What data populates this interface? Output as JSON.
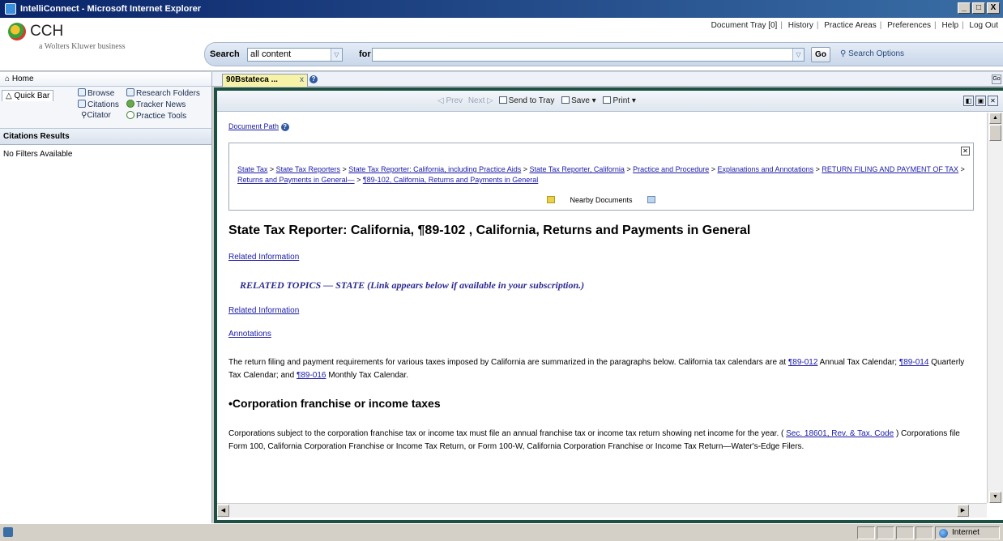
{
  "window": {
    "title": "IntelliConnect - Microsoft Internet Explorer",
    "controls": [
      "_",
      "□",
      "X"
    ]
  },
  "brand": {
    "name": "CCH",
    "tagline": "a Wolters Kluwer business"
  },
  "top_links": [
    "Document Tray [0]",
    "History",
    "Practice Areas",
    "Preferences",
    "Help",
    "Log Out"
  ],
  "search": {
    "label": "Search",
    "scope_value": "all content",
    "for_label": "for",
    "query_value": "",
    "go_label": "Go",
    "options_label": "Search Options"
  },
  "left_pane": {
    "home_label": "Home",
    "quickbar_label": "Quick Bar",
    "quick_items": {
      "browse": "Browse",
      "research_folders": "Research Folders",
      "citations": "Citations",
      "tracker_news": "Tracker News",
      "citator": "Citator",
      "practice_tools": "Practice Tools"
    },
    "results_header": "Citations Results",
    "no_filters": "No Filters Available"
  },
  "doc_tab": {
    "label": "90Bstateca ...",
    "close": "x"
  },
  "toolbar": {
    "prev": "Prev",
    "next": "Next",
    "send_to_tray": "Send to Tray",
    "save": "Save ▾",
    "print": "Print ▾"
  },
  "document": {
    "path_label": "Document Path",
    "breadcrumb": [
      "State Tax",
      "State Tax Reporters",
      "State Tax Reporter: California, including Practice Aids",
      "State Tax Reporter, California",
      "Practice and Procedure",
      "Explanations and Annotations",
      "RETURN FILING AND PAYMENT OF TAX",
      "Returns and Payments in General—",
      "¶89-102, California, Returns and Payments in General"
    ],
    "nearby_label": "Nearby Documents",
    "title": "State Tax Reporter: California, ¶89-102 , California, Returns and Payments in General",
    "related_info_1": "Related Information",
    "related_topics": "RELATED TOPICS — STATE (Link appears below if available in your subscription.)",
    "related_info_2": "Related Information",
    "annotations": "Annotations",
    "para1": {
      "text_a": "The return filing and payment requirements for various taxes imposed by California are summarized in the paragraphs below. California tax calendars are at ",
      "link_a": "¶89-012",
      "text_b": " Annual Tax Calendar; ",
      "link_b": "¶89-014",
      "text_c": " Quarterly Tax Calendar; and ",
      "link_c": "¶89-016",
      "text_d": " Monthly Tax Calendar."
    },
    "section_heading": "•Corporation franchise or income taxes",
    "para2": {
      "text_a": "Corporations subject to the corporation franchise tax or income tax must file an annual franchise tax or income tax return showing net income for the year. ( ",
      "link_a": "Sec. 18601, Rev. & Tax. Code",
      "text_b": " ) Corporations file Form 100, California Corporation Franchise or Income Tax Return, or Form 100-W, California Corporation Franchise or Income Tax Return—Water's-Edge Filers."
    }
  },
  "statusbar": {
    "zone": "Internet"
  }
}
